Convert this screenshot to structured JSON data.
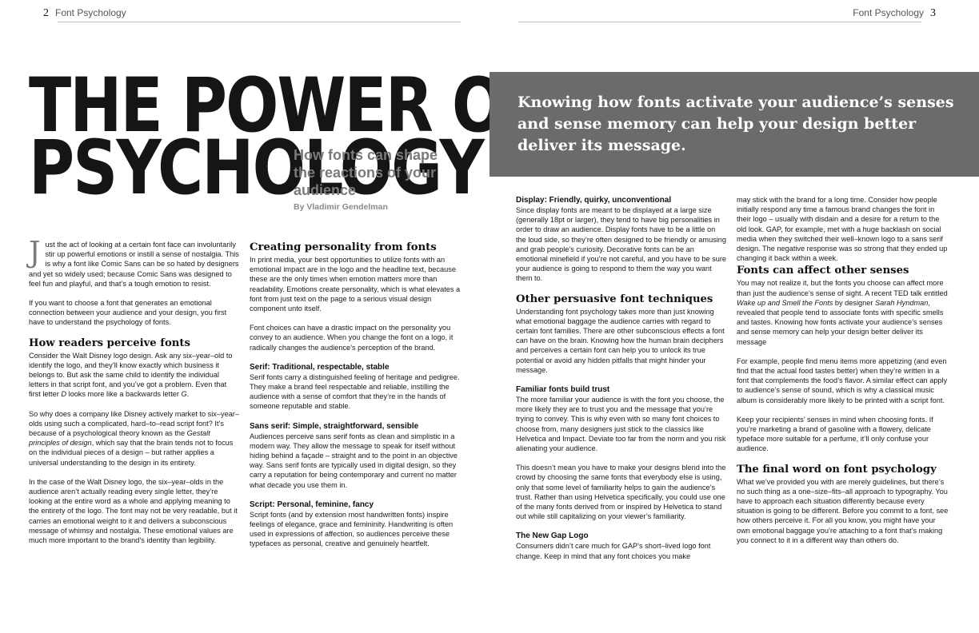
{
  "header": {
    "left_page": "2",
    "left_title": "Font Psychology",
    "right_title": "Font Psychology",
    "right_page": "3"
  },
  "title": {
    "line1": "THE POWER OF FONT",
    "line2": "PSYCHOLOGY",
    "subtitle": "How fonts can shape the reactions of your audience",
    "byline": "By Vladimir Gendelman"
  },
  "banner": "Knowing how fonts activate your audience’s senses and sense memory can help your design better deliver its message.",
  "col1": {
    "dropcap": "J",
    "intro": "ust the act of looking at a certain font face can involuntarily stir up powerful emotions or instill a sense of nostalgia. This is why a font like Comic Sans can be so hated by designers and yet so widely used; because Comic Sans was designed to feel fun and playful, and that’s a tough emotion to resist.",
    "p2": "If you want to choose a font that generates an emotional connection between your audience and your design, you first have to understand the psychology of fonts.",
    "h_perceive": "How readers perceive fonts",
    "p3_a": "Consider the Walt Disney logo design. Ask any six–year–old to identify the logo, and they’ll know exactly which business it belongs to. But ask the same child to identify the individual letters in that script font, and you’ve got a problem. Even that first letter ",
    "p3_d": "D",
    "p3_b": " looks more like a backwards letter ",
    "p3_g": "G",
    "p3_c": ".",
    "p4_a": "So why does a company like Disney actively market to six–year–olds using such a complicated, hard–to–read script font? It’s because of a psychological theory known as the ",
    "p4_em": "Gestalt principles of design",
    "p4_b": ", which say that the brain tends not to focus on the individual pieces of a design – but rather applies a universal understanding to the design in its entirety.",
    "p5": "In the case of the Walt Disney logo, the six–year–olds in the audience aren’t actually reading every single letter, they’re looking at the entire word as a whole and applying meaning to the entirety of the logo. The font may not be very readable, but it carries an emotional weight to it and delivers a subconscious message of whimsy and nostalgia. These emotional values are much more important to the brand’s identity than legibility."
  },
  "col2": {
    "h_personality": "Creating personality from fonts",
    "p1": "In print media, your best opportunities to utilize fonts with an emotional impact are in the logo and the headline text, because these are the only times when emotion matters more than readability. Emotions create personality, which is what elevates a font from just text on the page to a serious visual design component unto itself.",
    "p2": "Font choices can have a drastic impact on the personality you convey to an audience. When you change the font on a logo, it radically changes the audience’s perception of the brand.",
    "h_serif": "Serif: Traditional, respectable, stable",
    "p_serif": "Serif fonts carry a distinguished feeling of heritage and pedigree. They make a brand feel respectable and reliable, instilling the audience with a sense of comfort that they’re in the hands of someone reputable and stable.",
    "h_sans": "Sans serif: Simple, straightforward, sensible",
    "p_sans": "Audiences perceive sans serif fonts as clean and simplistic in a modern way. They allow the message to speak for itself without hiding behind a façade – straight and to the point in an objective way. Sans serif fonts are typically used in digital design, so they carry a reputation for being contemporary and current no matter what decade you use them in.",
    "h_script": "Script: Personal, feminine, fancy",
    "p_script": "Script fonts (and by extension most handwritten fonts) inspire feelings of elegance, grace and femininity. Handwriting is often used in expressions of affection, so audiences perceive these typefaces as personal, creative and genuinely heartfelt."
  },
  "col3": {
    "h_display": "Display: Friendly, quirky, unconventional",
    "p_display": "Since display fonts are meant to be displayed at a large size (generally 18pt or larger), they tend to have big personalities in order to draw an audience. Display fonts have to be a little on the loud side, so they’re often designed to be friendly or amusing and grab people’s curiosity. Decorative fonts can be an emotional minefield if you’re not careful, and you have to be sure your audience is going to respond to them the way you want them to.",
    "h_other": "Other persuasive font techniques",
    "p_other": "Understanding font psychology takes more than just knowing what emotional baggage the audience carries with regard to certain font families. There are other subconscious effects a font can have on the brain. Knowing how the human brain deciphers and perceives a certain font can help you to unlock its true potential or avoid any hidden pitfalls that might hinder your message.",
    "h_familiar": "Familiar fonts build trust",
    "p_familiar": "The more familiar your audience is with the font you choose, the more likely they are to trust you and the message that you’re trying to convey. This is why even with so many font choices to choose from, many designers just stick to the classics like Helvetica and Impact. Deviate too far from the norm and you risk alienating your audience.",
    "p_blend": "This doesn’t mean you have to make your designs blend into the crowd by choosing the same fonts that everybody else is using, only that some level of familiarity helps to gain the audience’s trust. Rather than using Helvetica specifically, you could use one of the many fonts derived from or inspired by Helvetica to stand out while still capitalizing on your viewer’s familiarity.",
    "h_gap": "The New Gap Logo",
    "p_gap": "Consumers didn’t care much for GAP’s short–lived logo font change. Keep in mind that any font choices you make"
  },
  "col4": {
    "p_cont": "may stick with the brand for a long time. Consider how people initially respond any time a famous brand changes the font in their logo – usually with disdain and a desire for a return to the old look. GAP, for example, met with a huge backlash on social media when they switched their well–known logo to a sans serif design. The negative response was so strong that they ended up changing it back within a week.",
    "h_senses": "Fonts can affect other senses",
    "p_senses_a": "You may not realize it, but the fonts you choose can affect more than just the audience’s sense of sight. A recent TED talk entitled ",
    "p_senses_em1": "Wake up and Smell the Fonts",
    "p_senses_b": " by designer ",
    "p_senses_em2": "Sarah Hyndman",
    "p_senses_c": ", revealed that people tend to associate fonts with specific smells and tastes. Knowing how fonts activate your audience’s senses and sense memory can help your design better deliver its message",
    "p_example": "For example, people find menu items more appetizing (and even find that the actual food tastes better) when they’re written in a font that complements the food’s flavor. A similar effect can apply to audience’s sense of sound, which is why a classical music album is considerably more likely to be printed with a script font.",
    "p_keep": "Keep your recipients’ senses in mind when choosing fonts. If you’re marketing a brand of gasoline with a flowery, delicate typeface more suitable for a perfume, it’ll only confuse your audience.",
    "h_final": "The final word on font psychology",
    "p_final": "What we’ve provided you with are merely guidelines, but there’s no such thing as a one–size–fits–all approach to typography. You have to approach each situation differently because every situation is going to be different. Before you commit to a font, see how others perceive it. For all you know, you might have your own emotional baggage you’re attaching to a font that’s making you connect to it in a different way than others do."
  }
}
